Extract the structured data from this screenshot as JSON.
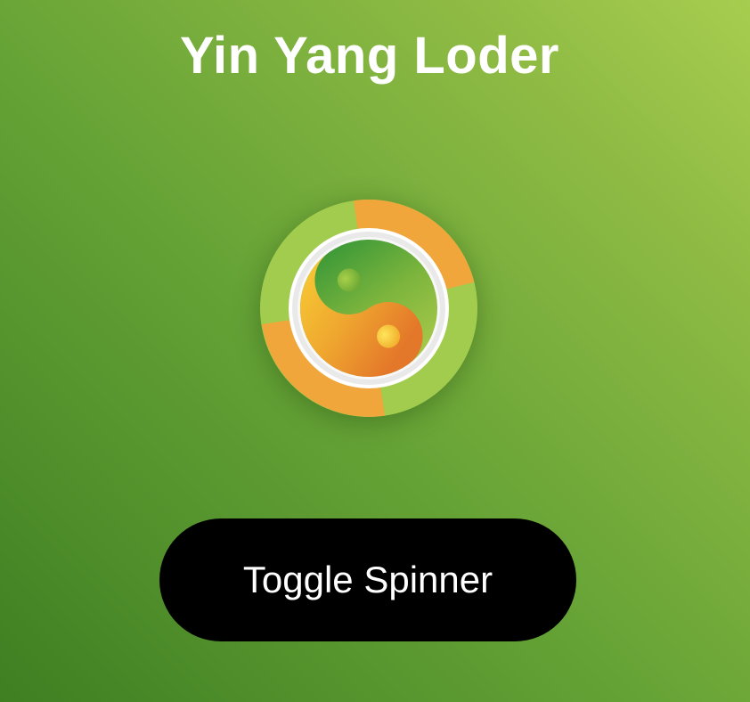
{
  "page": {
    "title": "Yin Yang Loder"
  },
  "spinner": {
    "icon": "yin-yang-icon",
    "colors": {
      "ring_green": "#a2cc4e",
      "ring_orange": "#f0a63b",
      "yin_top": "#f5c52f",
      "yin_bottom": "#e8802c",
      "yang": "#8dbd3c",
      "yang_dark": "#4f9a36"
    }
  },
  "controls": {
    "toggle_label": "Toggle Spinner"
  }
}
